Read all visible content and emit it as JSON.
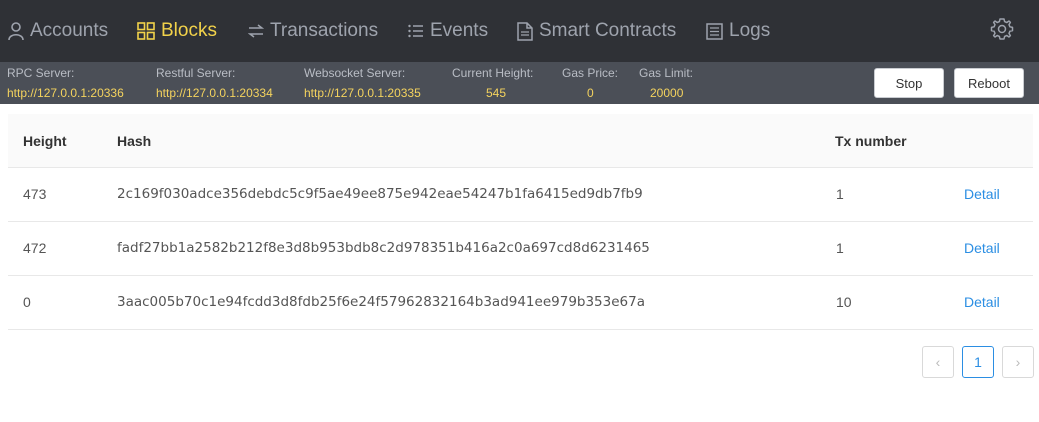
{
  "nav": {
    "items": [
      {
        "label": "Accounts",
        "icon": "user-icon",
        "active": false
      },
      {
        "label": "Blocks",
        "icon": "grid-icon",
        "active": true
      },
      {
        "label": "Transactions",
        "icon": "swap-icon",
        "active": false
      },
      {
        "label": "Events",
        "icon": "list-icon",
        "active": false
      },
      {
        "label": "Smart Contracts",
        "icon": "file-icon",
        "active": false
      },
      {
        "label": "Logs",
        "icon": "log-icon",
        "active": false
      }
    ],
    "settings_icon": "gear-icon"
  },
  "server": {
    "rpc": {
      "label": "RPC Server:",
      "value": "http://127.0.0.1:20336"
    },
    "restful": {
      "label": "Restful Server:",
      "value": "http://127.0.0.1:20334"
    },
    "websocket": {
      "label": "Websocket Server:",
      "value": "http://127.0.0.1:20335"
    },
    "height": {
      "label": "Current Height:",
      "value": "545"
    },
    "gas_price": {
      "label": "Gas Price:",
      "value": "0"
    },
    "gas_limit": {
      "label": "Gas Limit:",
      "value": "20000"
    },
    "stop_label": "Stop",
    "reboot_label": "Reboot"
  },
  "table": {
    "headers": {
      "height": "Height",
      "hash": "Hash",
      "tx": "Tx number"
    },
    "rows": [
      {
        "height": "473",
        "hash": "2c169f030adce356debdc5c9f5ae49ee875e942eae54247b1fa6415ed9db7fb9",
        "tx": "1",
        "action": "Detail"
      },
      {
        "height": "472",
        "hash": "fadf27bb1a2582b212f8e3d8b953bdb8c2d978351b416a2c0a697cd8d6231465",
        "tx": "1",
        "action": "Detail"
      },
      {
        "height": "0",
        "hash": "3aac005b70c1e94fcdd3d8fdb25f6e24f57962832164b3ad941ee979b353e67a",
        "tx": "10",
        "action": "Detail"
      }
    ]
  },
  "pagination": {
    "prev": "‹",
    "current": "1",
    "next": "›"
  },
  "colors": {
    "nav_bg": "#2f3136",
    "info_bg": "#4b4f57",
    "accent": "#f2d24a",
    "link": "#2b8ee3"
  }
}
